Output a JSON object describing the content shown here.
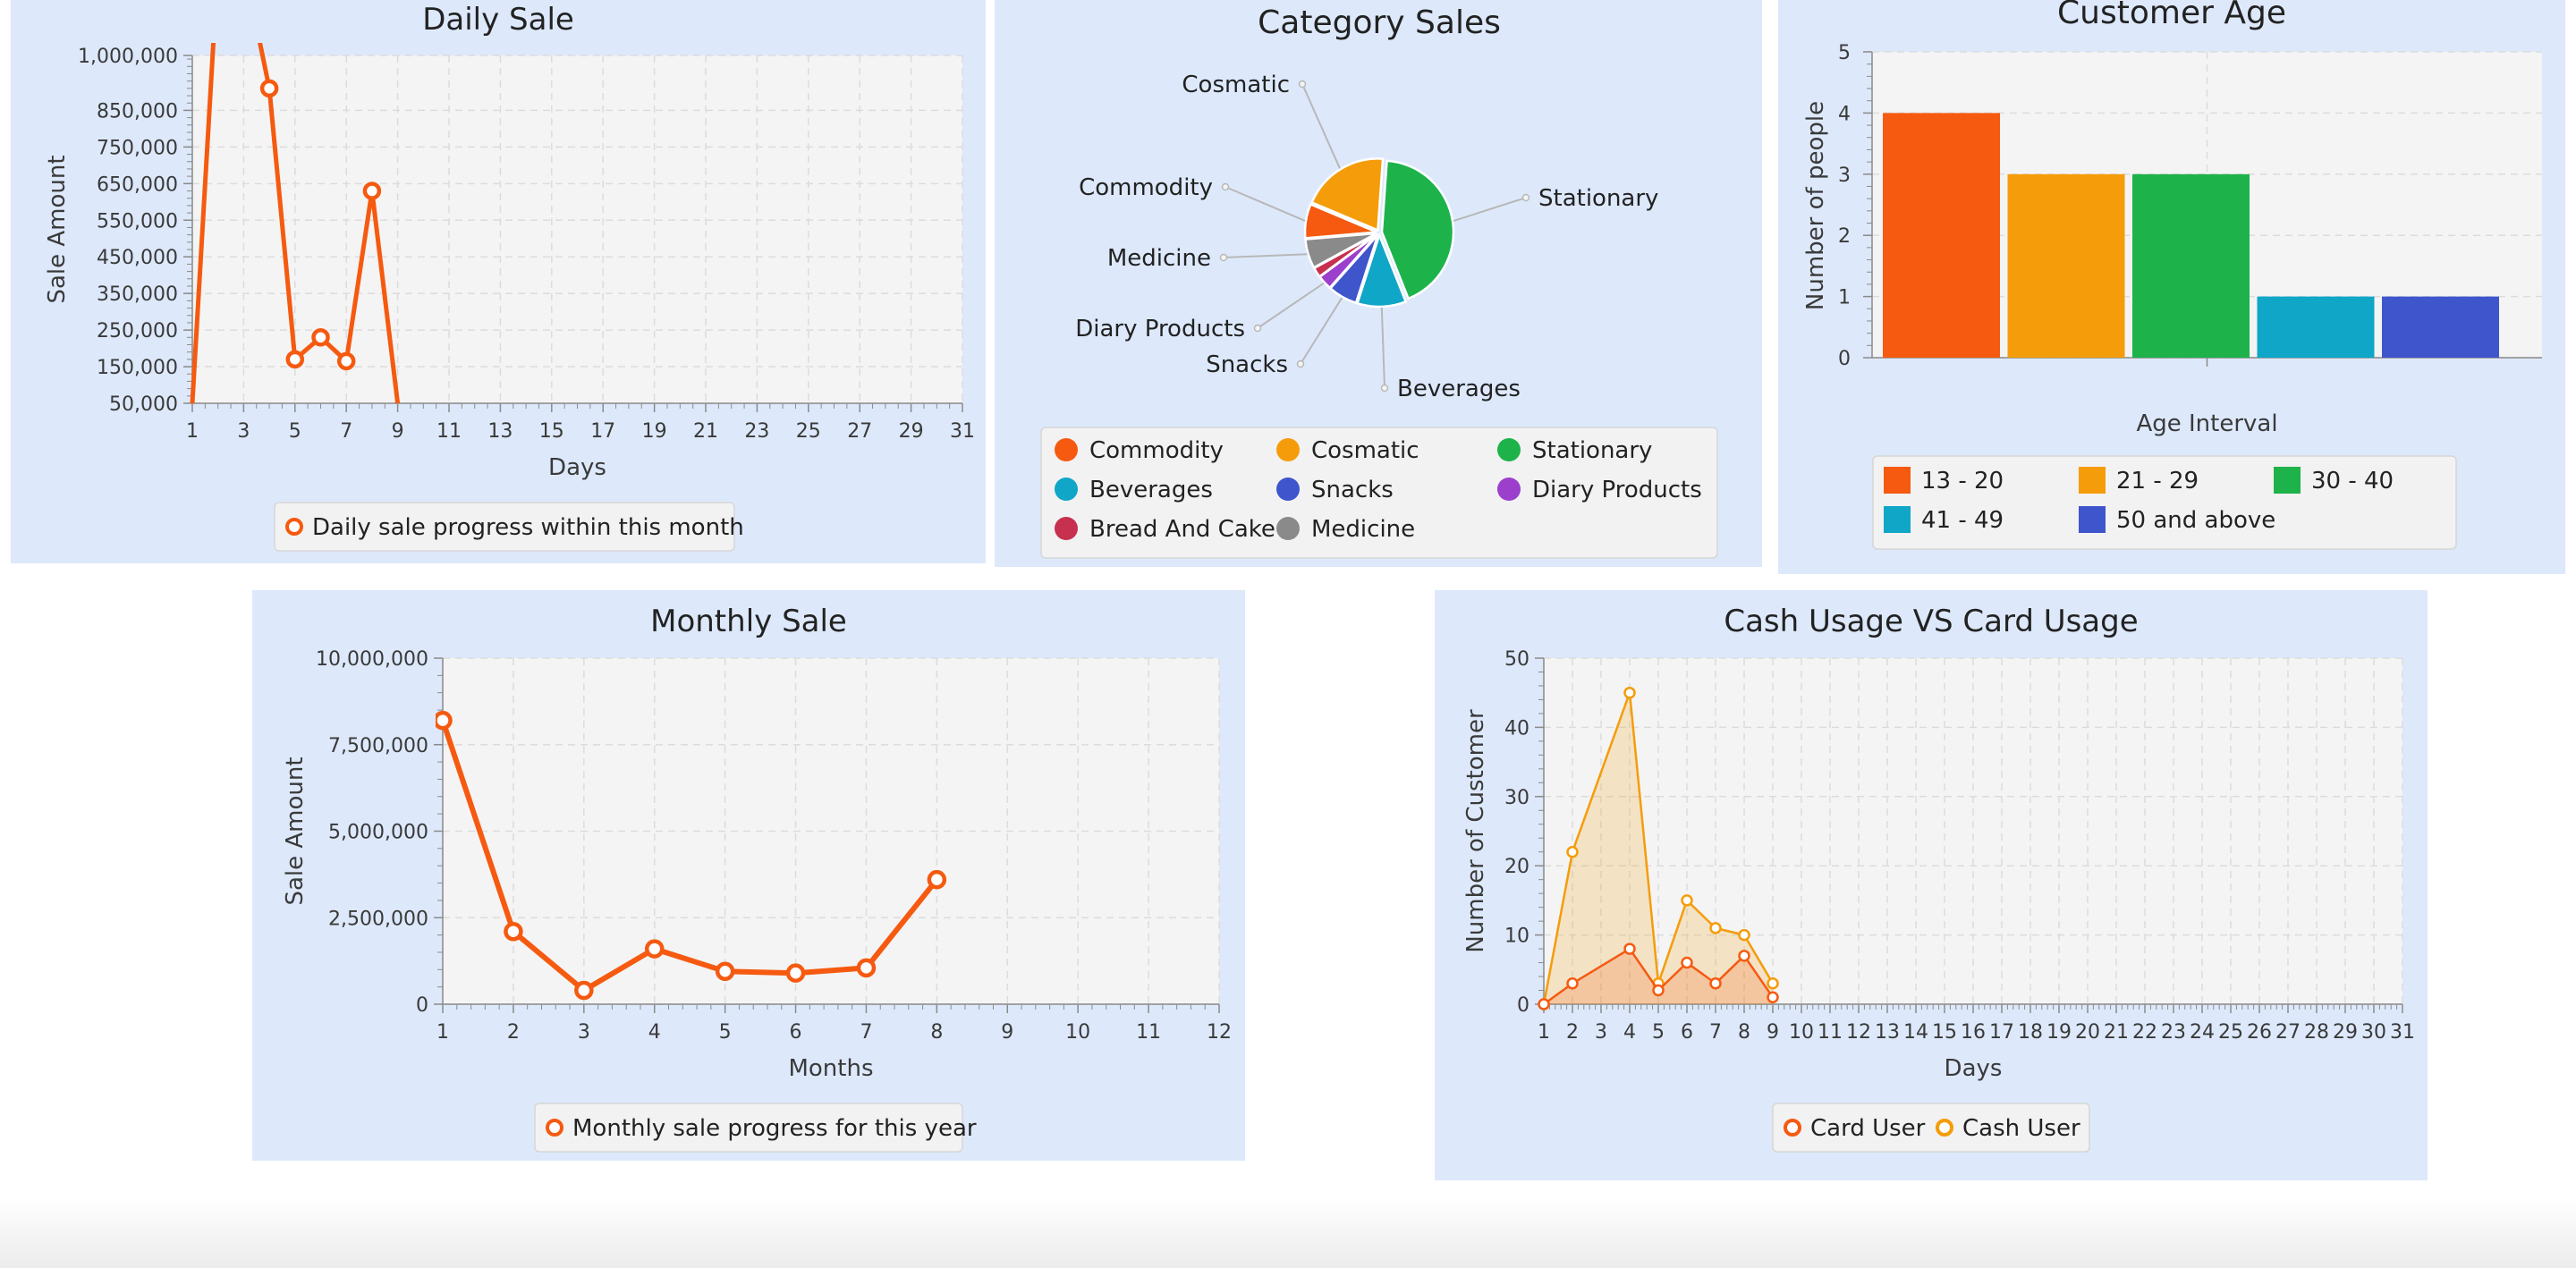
{
  "colors": {
    "orange": "#f55a10",
    "amber": "#f59c0a",
    "green": "#1db34a",
    "cyan": "#10a6c8",
    "blue": "#3f55cc",
    "purple": "#9c3fcc",
    "crimson": "#c8304f",
    "gray": "#8a8a8a"
  },
  "chart_data": [
    {
      "id": "daily",
      "type": "line",
      "title": "Daily Sale",
      "xlabel": "Days",
      "ylabel": "Sale Amount",
      "x_ticks": [
        1,
        3,
        5,
        7,
        9,
        11,
        13,
        15,
        17,
        19,
        21,
        23,
        25,
        27,
        29,
        31
      ],
      "xlim": [
        1,
        31
      ],
      "y_ticks": [
        50000,
        150000,
        250000,
        350000,
        450000,
        550000,
        650000,
        750000,
        850000,
        1000000
      ],
      "y_tick_labels": [
        "50,000",
        "150,000",
        "250,000",
        "350,000",
        "450,000",
        "550,000",
        "650,000",
        "750,000",
        "850,000",
        "1,000,000"
      ],
      "ylim": [
        50000,
        1000000
      ],
      "grid": true,
      "legend_position": "bottom",
      "series": [
        {
          "name": "Daily sale progress within this month",
          "x": [
            1,
            2,
            3,
            4,
            5,
            6,
            7,
            8,
            9
          ],
          "y": [
            50000,
            1250000,
            1250000,
            910000,
            170000,
            230000,
            165000,
            630000,
            50000
          ]
        }
      ]
    },
    {
      "id": "category",
      "type": "pie",
      "title": "Category Sales",
      "legend_position": "bottom",
      "slices": [
        {
          "label": "Stationary",
          "value": 39,
          "color": "#1db34a"
        },
        {
          "label": "Beverages",
          "value": 10,
          "color": "#10a6c8"
        },
        {
          "label": "Snacks",
          "value": 6,
          "color": "#3f55cc"
        },
        {
          "label": "Diary Products",
          "value": 3,
          "color": "#9c3fcc"
        },
        {
          "label": "Bread And Cake",
          "value": 2,
          "color": "#c8304f"
        },
        {
          "label": "Medicine",
          "value": 6,
          "color": "#8a8a8a"
        },
        {
          "label": "Commodity",
          "value": 7,
          "color": "#f55a10"
        },
        {
          "label": "Cosmatic",
          "value": 18,
          "color": "#f59c0a"
        }
      ],
      "legend": [
        "Commodity",
        "Cosmatic",
        "Stationary",
        "Beverages",
        "Snacks",
        "Diary Products",
        "Bread And Cake",
        "Medicine"
      ]
    },
    {
      "id": "age",
      "type": "bar",
      "title": "Customer Age",
      "xlabel": "Age Interval",
      "ylabel": "Number of people",
      "categories": [
        "13 - 20",
        "21 - 29",
        "30 - 40",
        "41 - 49",
        "50 and above"
      ],
      "values": [
        4,
        3,
        3,
        1,
        1
      ],
      "ylim": [
        0,
        5
      ],
      "y_ticks": [
        0,
        1,
        2,
        3,
        4,
        5
      ],
      "grid": true,
      "legend_position": "bottom"
    },
    {
      "id": "monthly",
      "type": "line",
      "title": "Monthly Sale",
      "xlabel": "Months",
      "ylabel": "Sale Amount",
      "x_ticks": [
        1,
        2,
        3,
        4,
        5,
        6,
        7,
        8,
        9,
        10,
        11,
        12
      ],
      "xlim": [
        1,
        12
      ],
      "y_ticks": [
        0,
        2500000,
        5000000,
        7500000,
        10000000
      ],
      "y_tick_labels": [
        "0",
        "2,500,000",
        "5,000,000",
        "7,500,000",
        "10,000,000"
      ],
      "ylim": [
        0,
        10000000
      ],
      "grid": true,
      "legend_position": "bottom",
      "series": [
        {
          "name": "Monthly sale progress for this year",
          "x": [
            1,
            2,
            3,
            4,
            5,
            6,
            7,
            8
          ],
          "y": [
            8200000,
            2100000,
            400000,
            1600000,
            950000,
            900000,
            1050000,
            3600000
          ]
        }
      ]
    },
    {
      "id": "cash",
      "type": "area",
      "title": "Cash Usage VS Card Usage",
      "xlabel": "Days",
      "ylabel": "Number of Customer",
      "x_ticks": [
        1,
        2,
        3,
        4,
        5,
        6,
        7,
        8,
        9,
        10,
        11,
        12,
        13,
        14,
        15,
        16,
        17,
        18,
        19,
        20,
        21,
        22,
        23,
        24,
        25,
        26,
        27,
        28,
        29,
        30,
        31
      ],
      "xlim": [
        1,
        31
      ],
      "y_ticks": [
        0,
        10,
        20,
        30,
        40,
        50
      ],
      "ylim": [
        0,
        50
      ],
      "grid": true,
      "legend_position": "bottom",
      "series": [
        {
          "name": "Card User",
          "x": [
            1,
            2,
            4,
            5,
            6,
            7,
            8,
            9
          ],
          "y": [
            0,
            3,
            8,
            2,
            6,
            3,
            7,
            1
          ]
        },
        {
          "name": "Cash User",
          "x": [
            1,
            2,
            4,
            5,
            6,
            7,
            8,
            9
          ],
          "y": [
            0,
            22,
            45,
            3,
            15,
            11,
            10,
            3
          ]
        }
      ]
    }
  ]
}
